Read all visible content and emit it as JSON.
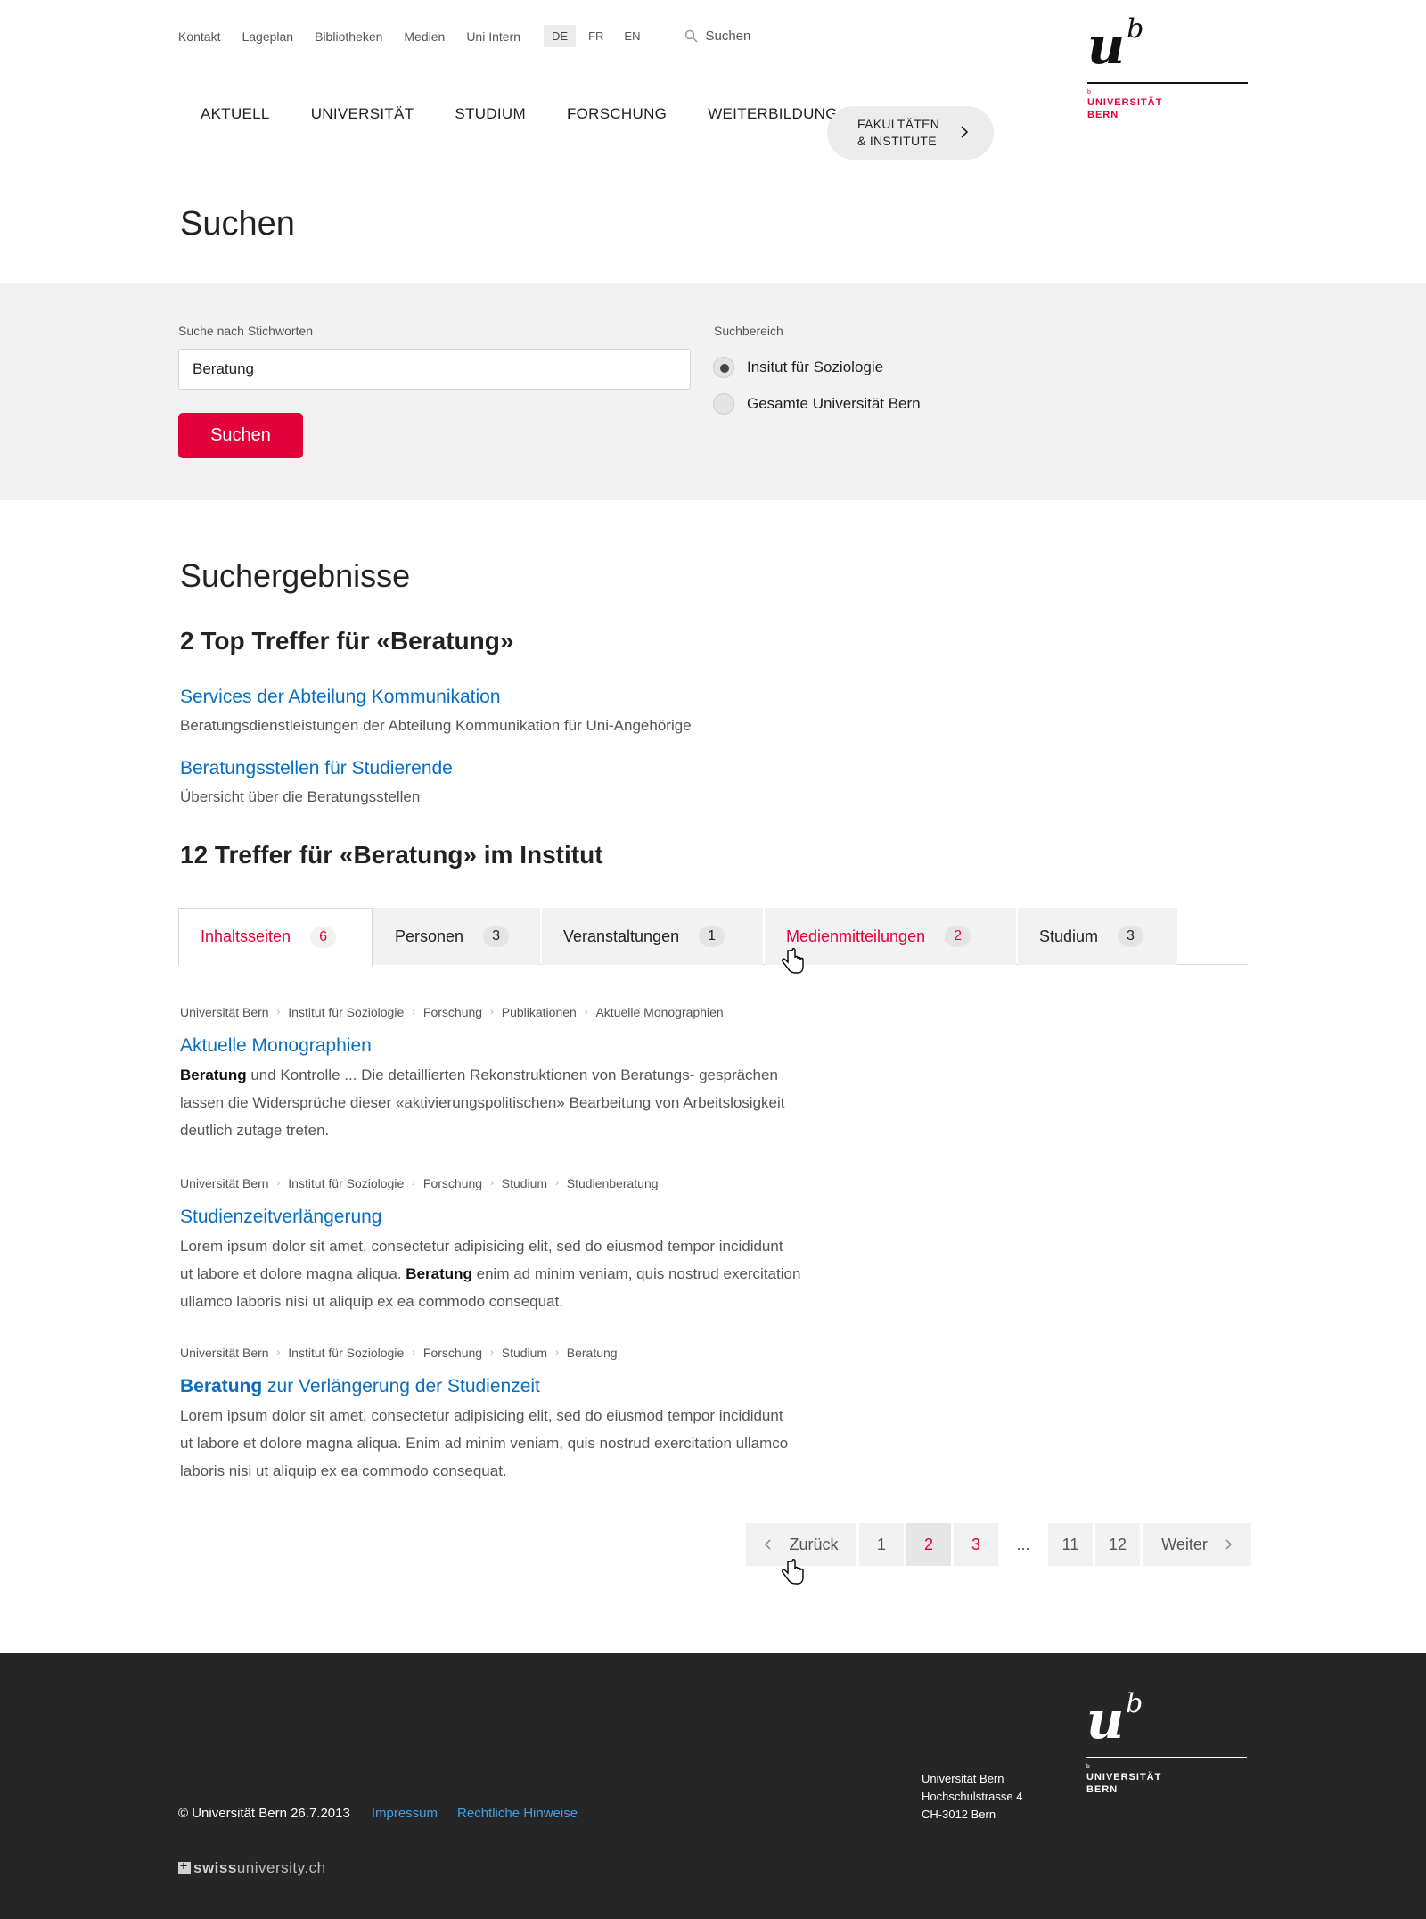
{
  "topnav": {
    "links": [
      "Kontakt",
      "Lageplan",
      "Bibliotheken",
      "Medien",
      "Uni Intern"
    ],
    "languages": [
      "DE",
      "FR",
      "EN"
    ],
    "active_language": "DE",
    "search_label": "Suchen"
  },
  "logo": {
    "letter": "u",
    "sup": "b",
    "small": "b",
    "line1": "UNIVERSITÄT",
    "line2": "BERN"
  },
  "mainnav": {
    "items": [
      "AKTUELL",
      "UNIVERSITÄT",
      "STUDIUM",
      "FORSCHUNG",
      "WEITERBILDUNG"
    ],
    "faculties_line1": "FAKULTÄTEN",
    "faculties_line2": "& INSTITUTE"
  },
  "page_title": "Suchen",
  "search": {
    "keyword_label": "Suche nach Stichworten",
    "keyword_value": "Beratung",
    "button_label": "Suchen",
    "scope_label": "Suchbereich",
    "scope_options": [
      "Insitut für Soziologie",
      "Gesamte Universität Bern"
    ],
    "scope_selected": "Insitut für Soziologie"
  },
  "results": {
    "title": "Suchergebnisse",
    "top_heading": "2 Top Treffer für «Beratung»",
    "top_hits": [
      {
        "title": "Services der Abteilung Kommunikation",
        "desc": "Beratungsdienstleistungen der Abteilung Kommunikation für Uni-Angehörige"
      },
      {
        "title": "Beratungsstellen für Studierende",
        "desc": "Übersicht über die Beratungsstellen"
      }
    ],
    "institute_heading": "12 Treffer für «Beratung» im Institut",
    "tabs": [
      {
        "label": "Inhaltsseiten",
        "count": "6"
      },
      {
        "label": "Personen",
        "count": "3"
      },
      {
        "label": "Veranstaltungen",
        "count": "1"
      },
      {
        "label": "Medienmitteilungen",
        "count": "2"
      },
      {
        "label": "Studium",
        "count": "3"
      }
    ],
    "active_tab": "Inhaltsseiten",
    "items": [
      {
        "crumbs": [
          "Universität Bern",
          "Institut für Soziologie",
          "Forschung",
          "Publikationen",
          "Aktuelle Monographien"
        ],
        "title_highlight": "",
        "title": "Aktuelle Monographien",
        "lines": [
          {
            "b": "Beratung",
            "t": " und Kontrolle ... Die detaillierten Rekonstruktionen von Beratungs- gesprächen"
          },
          {
            "b": "",
            "t": "lassen die Widersprüche dieser «aktivierungspolitischen» Bearbeitung von Arbeitslosigkeit"
          },
          {
            "b": "",
            "t": "deutlich zutage treten."
          }
        ]
      },
      {
        "crumbs": [
          "Universität Bern",
          "Institut für Soziologie",
          "Forschung",
          "Studium",
          "Studienberatung"
        ],
        "title_highlight": "",
        "title": "Studienzeitverlängerung",
        "lines": [
          {
            "pre": "",
            "b": "",
            "t": "Lorem ipsum dolor sit amet, consectetur adipisicing elit, sed do eiusmod tempor incididunt"
          },
          {
            "pre": "ut labore et dolore magna aliqua. ",
            "b": "Beratung",
            "t": " enim ad minim veniam, quis nostrud exercitation"
          },
          {
            "pre": "",
            "b": "",
            "t": "ullamco laboris nisi ut aliquip ex ea commodo consequat."
          }
        ]
      },
      {
        "crumbs": [
          "Universität Bern",
          "Institut für Soziologie",
          "Forschung",
          "Studium",
          "Beratung"
        ],
        "title_highlight": "Beratung",
        "title": " zur Verlängerung der Studienzeit",
        "lines": [
          {
            "b": "",
            "t": "Lorem ipsum dolor sit amet, consectetur adipisicing elit, sed do eiusmod tempor incididunt"
          },
          {
            "b": "",
            "t": "ut labore et dolore magna aliqua. Enim ad minim veniam, quis nostrud exercitation ullamco"
          },
          {
            "b": "",
            "t": "laboris nisi ut aliquip ex ea commodo consequat."
          }
        ]
      }
    ]
  },
  "pagination": {
    "prev": "Zurück",
    "pages": [
      "1",
      "2",
      "3",
      "...",
      "11",
      "12"
    ],
    "current": "2",
    "next": "Weiter"
  },
  "footer": {
    "copyright": "© Universität Bern 26.7.2013",
    "links": [
      "Impressum",
      "Rechtliche Hinweise"
    ],
    "address": [
      "Universität Bern",
      "Hochschulstrasse 4",
      "CH-3012 Bern"
    ],
    "swiss_bold": "swiss",
    "swiss_rest": "university.ch"
  },
  "colors": {
    "brand_red": "#e3003a",
    "link_blue": "#0a6dbf",
    "footer_bg": "#262626",
    "footer_link": "#3fa1e8"
  }
}
